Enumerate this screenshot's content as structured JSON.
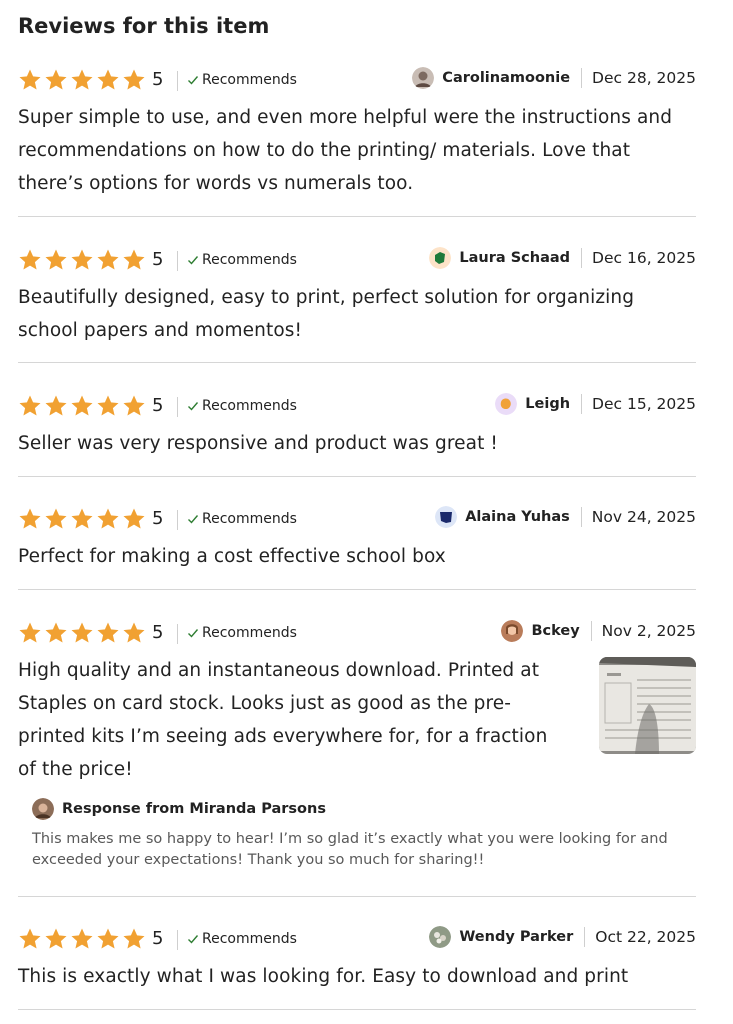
{
  "heading": "Reviews for this item",
  "colors": {
    "star": "#F1A132",
    "check": "#2E7D32",
    "divider": "#D6D6D6"
  },
  "reviews": [
    {
      "rating": 5,
      "rating_label": "5",
      "recommends": "Recommends",
      "reviewer": "Carolinamoonie",
      "date": "Dec 28, 2025",
      "avatar_icon": "user-photo-avatar",
      "text": "Super simple to use, and even more helpful were the instructions and recommendations on how to do the printing/ materials. Love that there’s options for words vs numerals too."
    },
    {
      "rating": 5,
      "rating_label": "5",
      "recommends": "Recommends",
      "reviewer": "Laura Schaad",
      "date": "Dec 16, 2025",
      "avatar_icon": "green-shape-avatar",
      "text": "Beautifully designed, easy to print, perfect solution for organizing school papers and momentos!"
    },
    {
      "rating": 5,
      "rating_label": "5",
      "recommends": "Recommends",
      "reviewer": "Leigh",
      "date": "Dec 15, 2025",
      "avatar_icon": "orange-shape-avatar",
      "text": "Seller was very responsive and product was great !"
    },
    {
      "rating": 5,
      "rating_label": "5",
      "recommends": "Recommends",
      "reviewer": "Alaina Yuhas",
      "date": "Nov 24, 2025",
      "avatar_icon": "navy-shape-avatar",
      "text": "Perfect for making a cost effective school box"
    },
    {
      "rating": 5,
      "rating_label": "5",
      "recommends": "Recommends",
      "reviewer": "Bckey",
      "date": "Nov 2, 2025",
      "avatar_icon": "user-photo-avatar",
      "text": "High quality and an instantaneous download. Printed at Staples on card stock. Looks just as good as the pre-printed kits I’m seeing ads everywhere for, for a fraction of the price!",
      "photo_icon": "review-photo-thumbnail",
      "response": {
        "title": "Response from Miranda Parsons",
        "text": "This makes me so happy to hear! I’m so glad it’s exactly what you were looking for and exceeded your expectations! Thank you so much for sharing!!"
      }
    },
    {
      "rating": 5,
      "rating_label": "5",
      "recommends": "Recommends",
      "reviewer": "Wendy Parker",
      "date": "Oct 22, 2025",
      "avatar_icon": "user-photo-avatar",
      "text": "This is exactly what I was looking for. Easy to download and print"
    }
  ]
}
